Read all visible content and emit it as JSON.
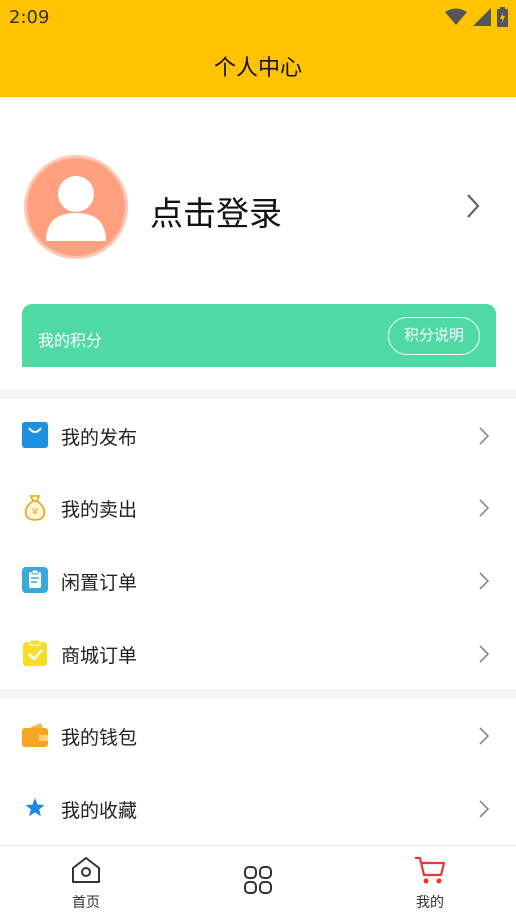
{
  "status_bar": {
    "time": "2:09"
  },
  "header": {
    "title": "个人中心"
  },
  "profile": {
    "login_text": "点击登录"
  },
  "points": {
    "label": "我的积分",
    "button_label": "积分说明"
  },
  "menu_group_1": [
    {
      "label": "我的发布",
      "icon": "shopping-bag-icon"
    },
    {
      "label": "我的卖出",
      "icon": "money-bag-icon"
    },
    {
      "label": "闲置订单",
      "icon": "clipboard-icon"
    },
    {
      "label": "商城订单",
      "icon": "checklist-icon"
    }
  ],
  "menu_group_2": [
    {
      "label": "我的钱包",
      "icon": "wallet-icon"
    },
    {
      "label": "我的收藏",
      "icon": "star-icon"
    }
  ],
  "tab_bar": [
    {
      "label": "首页",
      "icon": "home-icon"
    },
    {
      "label": "",
      "icon": "grid-icon"
    },
    {
      "label": "我的",
      "icon": "cart-icon"
    }
  ],
  "colors": {
    "header_bg": "#ffc300",
    "points_card": "#4fd9a5",
    "avatar_bg": "#ffa07f",
    "active_tab": "#e53935"
  }
}
